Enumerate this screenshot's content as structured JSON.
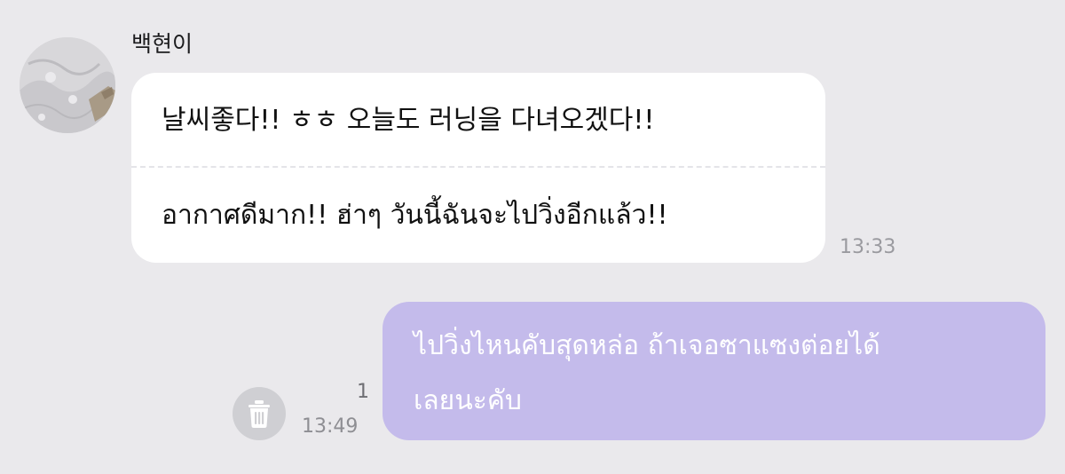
{
  "incoming": {
    "sender_name": "백현이",
    "lines": [
      "날씨좋다!! ㅎㅎ 오늘도 러닝을 다녀오겠다!!",
      "อากาศดีมาก!! ฮ่าๆ วันนี้ฉันจะไปวิ่งอีกแล้ว!!"
    ],
    "time": "13:33"
  },
  "outgoing": {
    "lines": [
      "ไปวิ่งไหนคับสุดหล่อ ถ้าเจอซาแซงต่อยได้",
      "เลยนะคับ"
    ],
    "read_count": "1",
    "time": "13:49"
  },
  "colors": {
    "background": "#eae9ec",
    "incoming_bubble": "#ffffff",
    "outgoing_bubble": "#c4bbeb",
    "timestamp": "#9a9a9f"
  },
  "icons": {
    "delete": "trash-icon"
  }
}
